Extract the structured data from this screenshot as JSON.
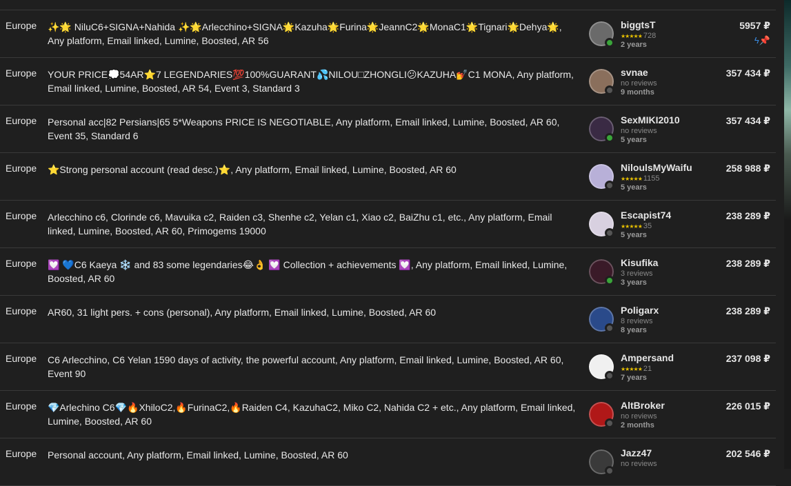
{
  "colors": {
    "background": "#1f1f1f",
    "text": "#e6e6e6",
    "star": "#e8c000",
    "online": "#3aa53a",
    "offline": "#555555"
  },
  "listings": [
    {
      "region": "Europe",
      "title": "✨🌟 NiluC6+SIGNA+Nahida ✨🌟Arlecchino+SIGNA🌟Kazuha🌟Furina🌟JeannC2🌟MonaC1🌟Tignari🌟Dehya🌟, Any platform, Email linked, Lumine, Boosted, AR 56",
      "seller": "biggtsT",
      "reviews": "728",
      "has_stars": true,
      "age": "2 years",
      "price": "5957 ₽",
      "online": true,
      "badges": true,
      "avatar": "#6a6a6a"
    },
    {
      "region": "Europe",
      "title": "YOUR PRICE💭54AR⭐7 LEGENDARIES💯100%GUARANT💦NILOU□ZHONGLI😕KAZUHA💅C1 MONA, Any platform, Email linked, Lumine, Boosted, AR 54, Event 3, Standard 3",
      "seller": "svnae",
      "reviews": "no reviews",
      "has_stars": false,
      "age": "9 months",
      "price": "357 434 ₽",
      "online": false,
      "badges": false,
      "avatar": "#8a6f5c"
    },
    {
      "region": "Europe",
      "title": "Personal acc|82 Persians|65 5*Weapons PRICE IS NEGOTIABLE, Any platform, Email linked, Lumine, Boosted, AR 60, Event 35, Standard 6",
      "seller": "SexMIKI2010",
      "reviews": "no reviews",
      "has_stars": false,
      "age": "5 years",
      "price": "357 434 ₽",
      "online": true,
      "badges": false,
      "avatar": "#3a2a44"
    },
    {
      "region": "Europe",
      "title": "⭐Strong personal account (read desc.)⭐, Any platform, Email linked, Lumine, Boosted, AR 60",
      "seller": "NiloulsMyWaifu",
      "reviews": "1155",
      "has_stars": true,
      "age": "5 years",
      "price": "258 988 ₽",
      "online": false,
      "badges": false,
      "avatar": "#b8b0d8"
    },
    {
      "region": "Europe",
      "title": "Arlecchino c6, Clorinde c6, Mavuika c2, Raiden c3, Shenhe c2, Yelan c1, Xiao c2, BaiZhu c1, etc., Any platform, Email linked, Lumine, Boosted, AR 60, Primogems 19000",
      "seller": "Escapist74",
      "reviews": "35",
      "has_stars": true,
      "age": "5 years",
      "price": "238 289 ₽",
      "online": false,
      "badges": false,
      "avatar": "#d8d0e0"
    },
    {
      "region": "Europe",
      "title": "💟 💙C6 Kaeya ❄️ and 83 some legendaries😂👌 💟 Collection + achievements 💟, Any platform, Email linked, Lumine, Boosted, AR 60",
      "seller": "Kisufika",
      "reviews": "3 reviews",
      "has_stars": false,
      "age": "3 years",
      "price": "238 289 ₽",
      "online": true,
      "badges": false,
      "avatar": "#3a1a28"
    },
    {
      "region": "Europe",
      "title": "AR60, 31 light pers. + cons (personal), Any platform, Email linked, Lumine, Boosted, AR 60",
      "seller": "Poligarx",
      "reviews": "8 reviews",
      "has_stars": false,
      "age": "8 years",
      "price": "238 289 ₽",
      "online": false,
      "badges": false,
      "avatar": "#2a4a8a"
    },
    {
      "region": "Europe",
      "title": "C6 Arlecchino, C6 Yelan 1590 days of activity, the powerful account, Any platform, Email linked, Lumine, Boosted, AR 60, Event 90",
      "seller": "Ampersand",
      "reviews": "21",
      "has_stars": true,
      "age": "7 years",
      "price": "237 098 ₽",
      "online": false,
      "badges": false,
      "avatar": "#f0f0f0"
    },
    {
      "region": "Europe",
      "title": "💎Arlechino C6💎🔥XhiloC2,🔥FurinaC2,🔥Raiden C4, KazuhaC2, Miko C2, Nahida C2 + etc., Any platform, Email linked, Lumine, Boosted, AR 60",
      "seller": "AltBroker",
      "reviews": "no reviews",
      "has_stars": false,
      "age": "2 months",
      "price": "226 015 ₽",
      "online": false,
      "badges": false,
      "avatar": "#b01818"
    },
    {
      "region": "Europe",
      "title": "Personal account, Any platform, Email linked, Lumine, Boosted, AR 60",
      "seller": "Jazz47",
      "reviews": "no reviews",
      "has_stars": false,
      "age": "",
      "price": "202 546 ₽",
      "online": false,
      "badges": false,
      "avatar": "#3a3a3a"
    }
  ],
  "stars_text": "★★★★★",
  "badge_icons": {
    "bolt": "ϟ",
    "pin": "📌"
  }
}
